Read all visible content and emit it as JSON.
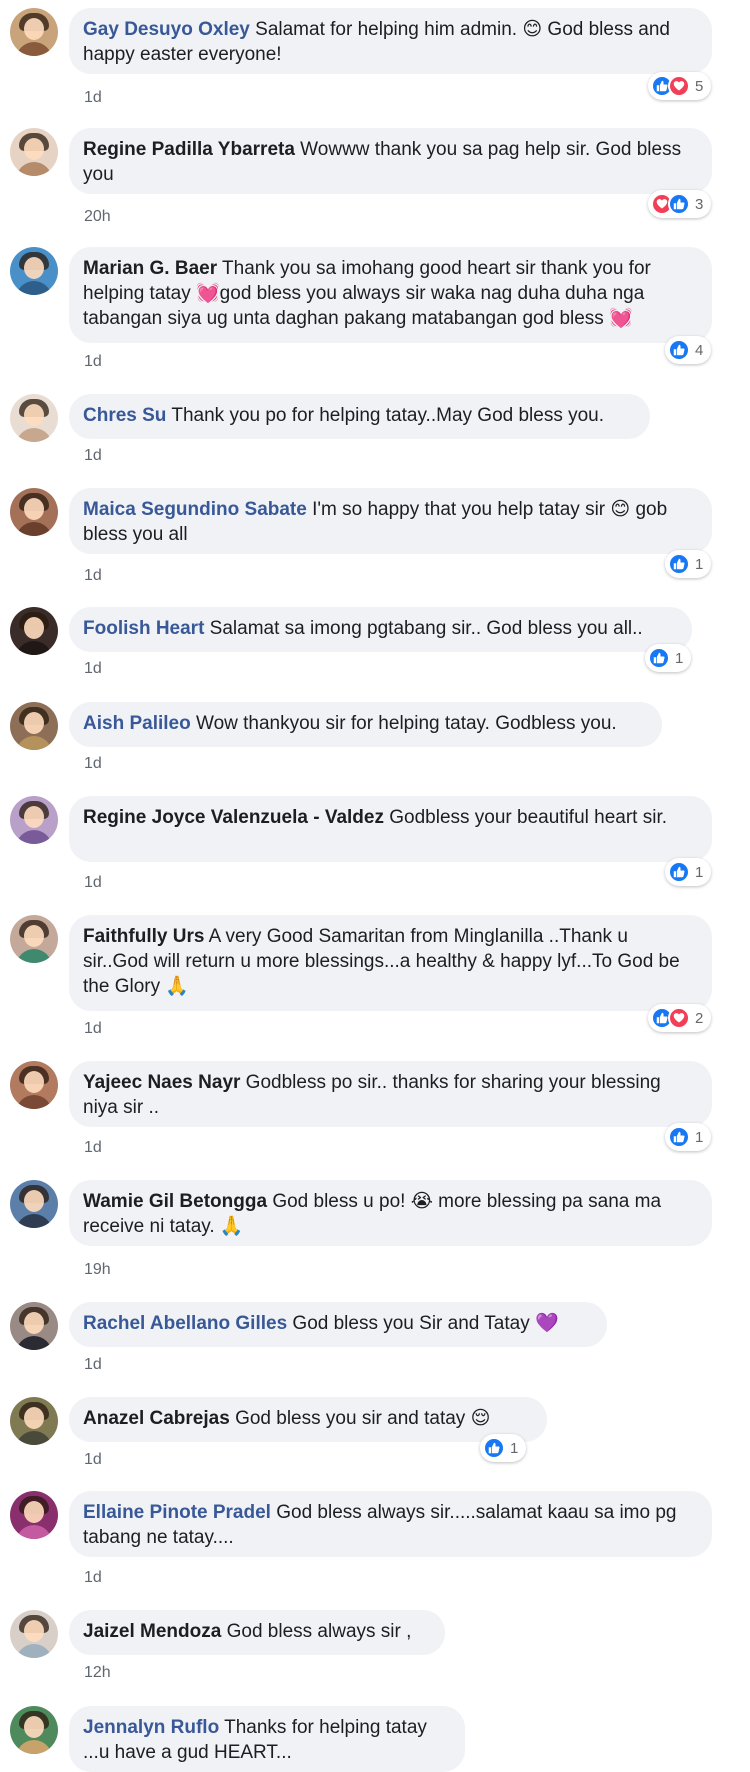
{
  "comments": [
    {
      "author": "Gay Desuyo Oxley",
      "text": " Salamat for helping him admin. 😊 God bless and happy easter everyone!",
      "time": "1d",
      "reaction_count": "5"
    },
    {
      "author": "Regine Padilla Ybarreta",
      "text": " Wowww thank you sa pag help sir. God bless you",
      "time": "20h",
      "reaction_count": "3"
    },
    {
      "author": "Marian G. Baer",
      "text": " Thank you sa imohang good heart sir thank you for helping tatay 💓god bless you always sir waka nag duha duha nga tabangan siya ug unta daghan pakang matabangan god bless 💓",
      "time": "1d",
      "reaction_count": "4"
    },
    {
      "author": "Chres Su",
      "text": " Thank you po for helping tatay..May God bless you.",
      "time": "1d",
      "reaction_count": ""
    },
    {
      "author": "Maica Segundino Sabate",
      "text": " I'm so happy that you help tatay sir 😊 gob bless you all",
      "time": "1d",
      "reaction_count": "1"
    },
    {
      "author": "Foolish Heart",
      "text": " Salamat sa imong pgtabang sir.. God bless you all..",
      "time": "1d",
      "reaction_count": "1"
    },
    {
      "author": "Aish Palileo",
      "text": " Wow thankyou sir for helping tatay. Godbless you.",
      "time": "1d",
      "reaction_count": ""
    },
    {
      "author": "Regine Joyce Valenzuela - Valdez",
      "text": " Godbless your beautiful heart sir.",
      "time": "1d",
      "reaction_count": "1"
    },
    {
      "author": "Faithfully Urs",
      "text": " A very Good Samaritan from Minglanilla ..Thank u sir..God will return u more blessings...a healthy & happy lyf...To God be the Glory 🙏",
      "time": "1d",
      "reaction_count": "2"
    },
    {
      "author": "Yajeec Naes Nayr",
      "text": " Godbless po sir.. thanks for sharing your blessing niya sir ..",
      "time": "1d",
      "reaction_count": "1"
    },
    {
      "author": "Wamie Gil Betongga",
      "text": " God bless u po! 😭 more blessing pa sana ma receive ni tatay. 🙏",
      "time": "19h",
      "reaction_count": ""
    },
    {
      "author": "Rachel Abellano Gilles",
      "text": " God bless you Sir and Tatay 💜",
      "time": "1d",
      "reaction_count": ""
    },
    {
      "author": "Anazel Cabrejas",
      "text": " God bless you sir and tatay 😌",
      "time": "1d",
      "reaction_count": "1"
    },
    {
      "author": "Ellaine Pinote Pradel",
      "text": " God bless always sir.....salamat kaau sa imo pg tabang ne tatay....",
      "time": "1d",
      "reaction_count": ""
    },
    {
      "author": "Jaizel Mendoza",
      "text": " God bless always sir ,",
      "time": "12h",
      "reaction_count": ""
    },
    {
      "author": "Jennalyn Ruflo",
      "text": " Thanks for helping tatay ...u have a gud HEART...",
      "time": "",
      "reaction_count": ""
    }
  ],
  "colors": {
    "link": "#385898",
    "bubble": "#f0f2f5",
    "like": "#1877f2",
    "love": "#f33e58"
  }
}
